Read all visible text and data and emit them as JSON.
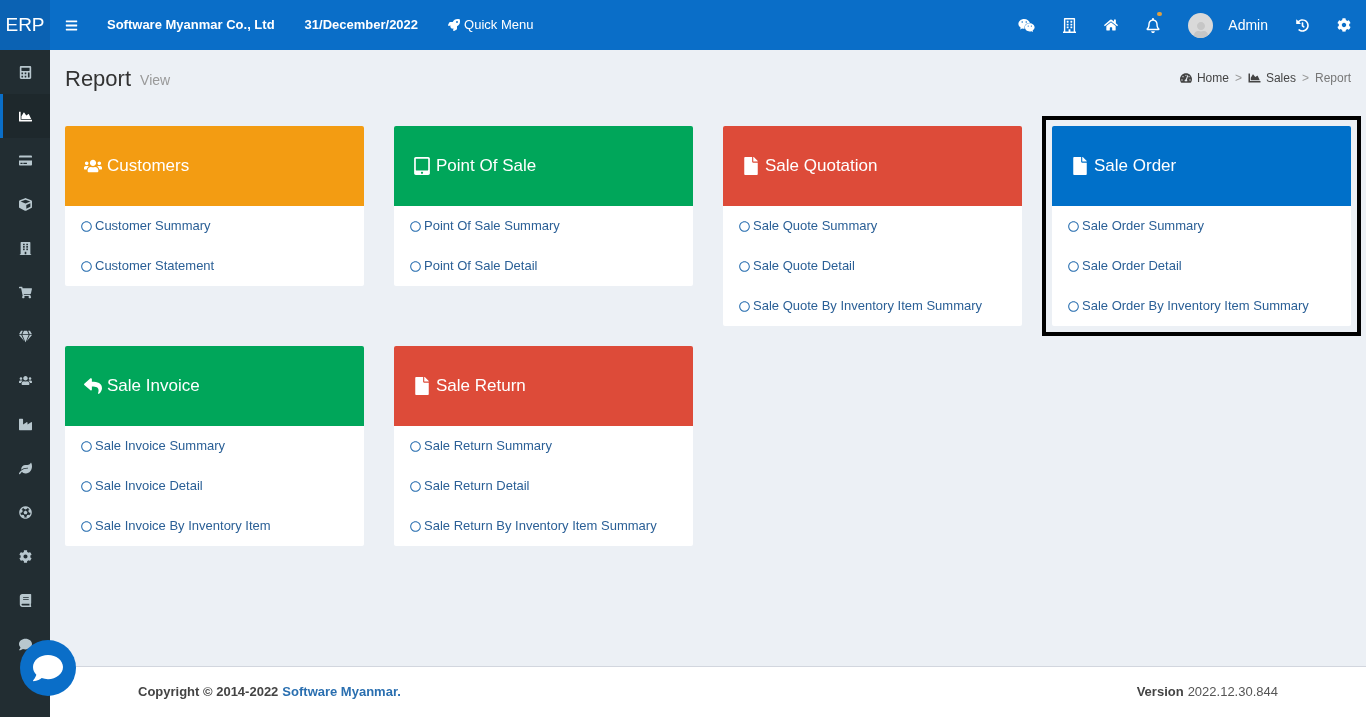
{
  "topbar": {
    "logo": "ERP",
    "company": "Software Myanmar Co., Ltd",
    "date": "31/December/2022",
    "quick_menu": "Quick Menu",
    "notification_dot": true,
    "user": "Admin"
  },
  "sidebar": {
    "items": [
      {
        "kind": "calculator",
        "selected": false
      },
      {
        "kind": "chart",
        "selected": true
      },
      {
        "kind": "card",
        "selected": false
      },
      {
        "kind": "cube",
        "selected": false
      },
      {
        "kind": "building",
        "selected": false
      },
      {
        "kind": "cart",
        "selected": false
      },
      {
        "kind": "gem",
        "selected": false
      },
      {
        "kind": "users",
        "selected": false
      },
      {
        "kind": "industry",
        "selected": false
      },
      {
        "kind": "leaf",
        "selected": false
      },
      {
        "kind": "ball",
        "selected": false
      },
      {
        "kind": "gear",
        "selected": false
      },
      {
        "kind": "book",
        "selected": false
      },
      {
        "kind": "comment",
        "selected": false
      }
    ]
  },
  "page": {
    "title": "Report",
    "subtitle": "View",
    "breadcrumb": [
      {
        "kind": "home",
        "label": "Home"
      },
      {
        "kind": "separator",
        "label": ">"
      },
      {
        "kind": "sales",
        "label": "Sales"
      },
      {
        "kind": "separator",
        "label": ">"
      },
      {
        "kind": "current",
        "label": "Report"
      }
    ]
  },
  "cards": [
    {
      "title": "Customers",
      "kind": "users",
      "color": "#f39c12",
      "highlighted": false,
      "links": [
        "Customer Summary",
        "Customer Statement"
      ]
    },
    {
      "title": "Point Of Sale",
      "kind": "tablet",
      "color": "#00a65a",
      "highlighted": false,
      "links": [
        "Point Of Sale Summary",
        "Point Of Sale Detail"
      ]
    },
    {
      "title": "Sale Quotation",
      "kind": "file",
      "color": "#dd4b39",
      "highlighted": false,
      "links": [
        "Sale Quote Summary",
        "Sale Quote Detail",
        "Sale Quote By Inventory Item Summary"
      ]
    },
    {
      "title": "Sale Order",
      "kind": "file",
      "color": "#0070c9",
      "highlighted": true,
      "links": [
        "Sale Order Summary",
        "Sale Order Detail",
        "Sale Order By Inventory Item Summary"
      ]
    },
    {
      "title": "Sale Invoice",
      "kind": "reply",
      "color": "#00a65a",
      "highlighted": false,
      "links": [
        "Sale Invoice Summary",
        "Sale Invoice Detail",
        "Sale Invoice By Inventory Item"
      ]
    },
    {
      "title": "Sale Return",
      "kind": "file",
      "color": "#dd4b39",
      "highlighted": false,
      "links": [
        "Sale Return Summary",
        "Sale Return Detail",
        "Sale Return By Inventory Item Summary"
      ]
    }
  ],
  "footer": {
    "copyright": "Copyright © 2014-2022",
    "company_link": "Software Myanmar.",
    "version_label": "Version",
    "version": "2022.12.30.844"
  }
}
